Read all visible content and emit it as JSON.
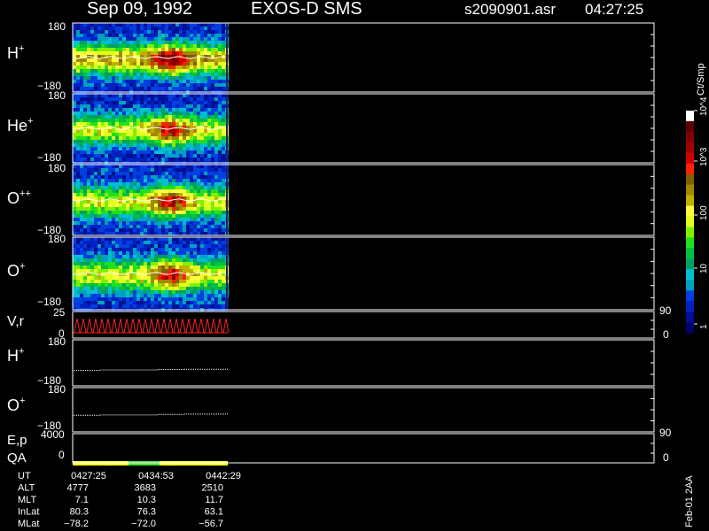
{
  "header": {
    "date": "Sep 09, 1992",
    "mission": "EXOS-D SMS",
    "file": "s2090901.asr",
    "time": "04:27:25"
  },
  "colors": {
    "background": "#000000",
    "axis": "#ffffff",
    "velocity_trace": "#ff2020",
    "qa_good": "#ffff30",
    "qa_mid": "#40e040"
  },
  "colorbar": {
    "title": "Ct/Smp",
    "ticks": [
      "1",
      "10",
      "100",
      "10^3",
      "10^4"
    ],
    "scale": "log",
    "range": [
      1,
      10000
    ],
    "colors": [
      "#000070",
      "#001090",
      "#0020c0",
      "#0040e0",
      "#00a0c0",
      "#00c0d0",
      "#00a060",
      "#00c040",
      "#20e020",
      "#80f000",
      "#e0ff20",
      "#ffff40",
      "#c0b000",
      "#a08800",
      "#806000",
      "#ff2000",
      "#d00000",
      "#a00000",
      "#800000",
      "#600000",
      "#ffffff"
    ]
  },
  "panels": [
    {
      "label_main": "H",
      "label_sup": "+",
      "ymax": "180",
      "ymin": "−180"
    },
    {
      "label_main": "He",
      "label_sup": "+",
      "ymax": "180",
      "ymin": "−180"
    },
    {
      "label_main": "O",
      "label_sup": "++",
      "ymax": "180",
      "ymin": "−180"
    },
    {
      "label_main": "O",
      "label_sup": "+",
      "ymax": "180",
      "ymin": "−180"
    }
  ],
  "vr_panel": {
    "label": "V,r",
    "ytop": "25",
    "ybottom": "0",
    "right_top": "90",
    "right_bottom": "0"
  },
  "line_panels": [
    {
      "label_main": "H",
      "label_sup": "+",
      "ymax": "180",
      "ymin": "−180"
    },
    {
      "label_main": "O",
      "label_sup": "+",
      "ymax": "180",
      "ymin": "−180"
    }
  ],
  "ep_panel": {
    "label_top": "E,p",
    "label_bottom": "QA",
    "ytop": "4000",
    "ybottom": "0",
    "right_top": "90",
    "right_bottom": "0"
  },
  "side_note": "Feb-01 2AA",
  "chart_data": {
    "type": "heatmap",
    "title": "Sep 09, 1992   EXOS-D SMS",
    "x_ticks_ut": [
      "0427:25",
      "0434:53",
      "0442:29"
    ],
    "ephemeris": [
      {
        "name": "UT",
        "values": [
          "0427:25",
          "0434:53",
          "0442:29"
        ]
      },
      {
        "name": "ALT",
        "values": [
          "4777",
          "3683",
          "2510"
        ]
      },
      {
        "name": "MLT",
        "values": [
          "7.1",
          "10.3",
          "11.7"
        ]
      },
      {
        "name": "InLat",
        "values": [
          "80.3",
          "76.3",
          "63.1"
        ]
      },
      {
        "name": "MLat",
        "values": [
          "−78.2",
          "−72.0",
          "−56.7"
        ]
      }
    ],
    "qa_segments": [
      {
        "from": 0.0,
        "to": 0.36,
        "level": "good"
      },
      {
        "from": 0.36,
        "to": 0.56,
        "level": "mid"
      },
      {
        "from": 0.56,
        "to": 1.0,
        "level": "good"
      }
    ],
    "line_levels": [
      {
        "panel": "H+",
        "segments": [
          [
            0.0,
            0.18,
            -60
          ],
          [
            0.18,
            0.55,
            -55
          ],
          [
            0.55,
            0.72,
            -52
          ],
          [
            0.72,
            1.0,
            -50
          ]
        ]
      },
      {
        "panel": "O+",
        "segments": [
          [
            0.0,
            0.18,
            -45
          ],
          [
            0.18,
            0.55,
            -42
          ],
          [
            0.55,
            0.72,
            -38
          ],
          [
            0.72,
            1.0,
            -35
          ]
        ]
      }
    ]
  }
}
